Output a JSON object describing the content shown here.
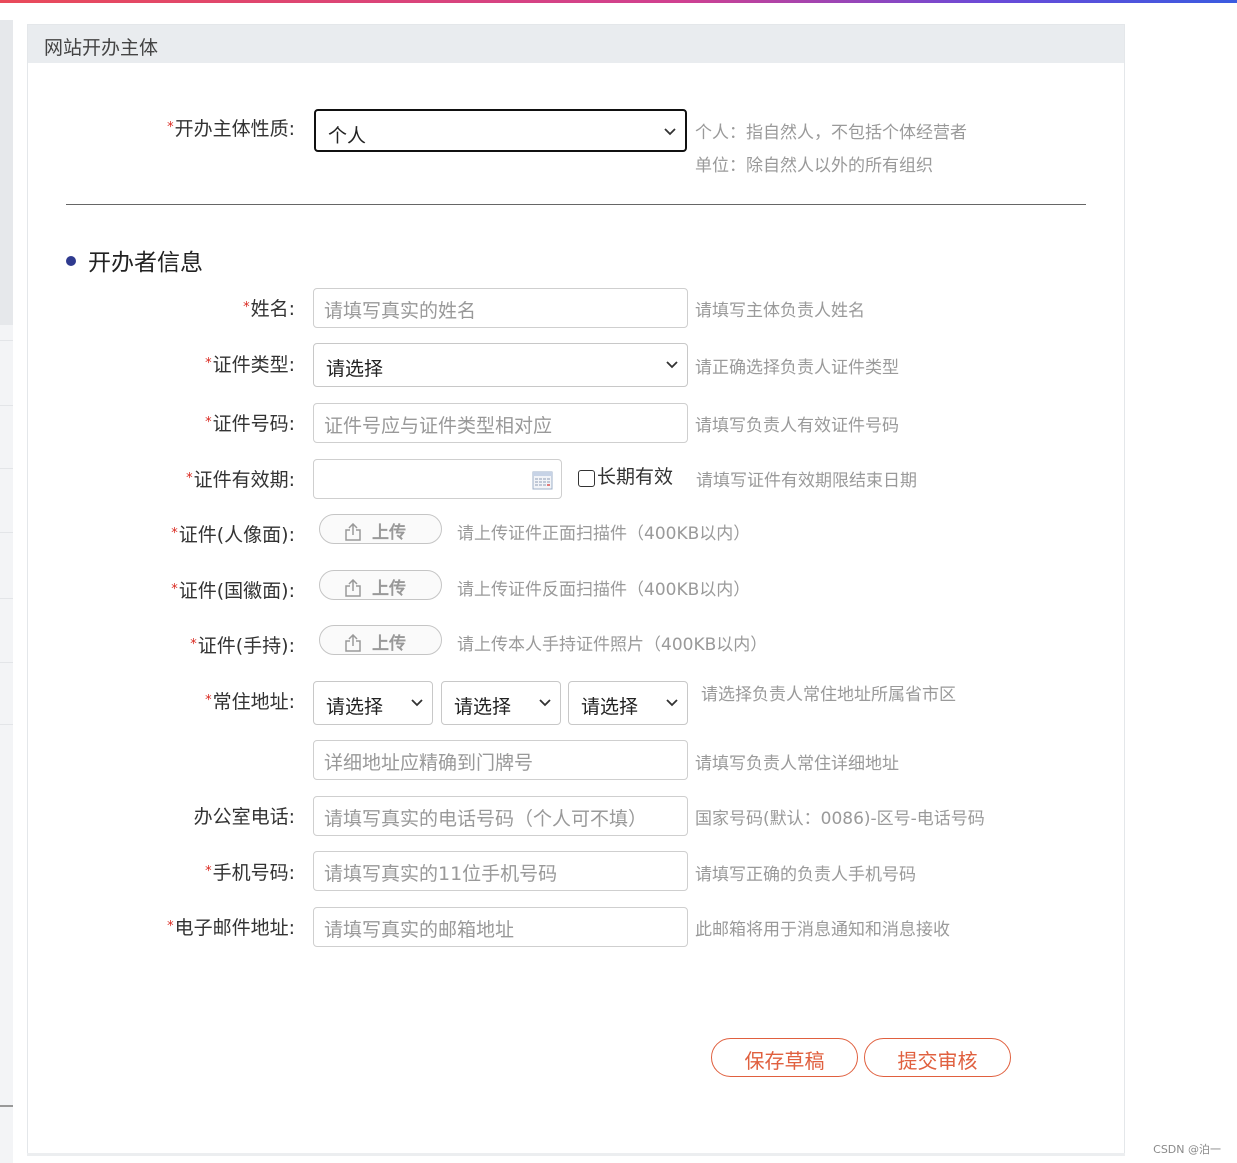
{
  "panel": {
    "title": "网站开办主体"
  },
  "subject_type": {
    "label": "开办主体性质:",
    "selected": "个人",
    "hint_person": "个人：指自然人，不包括个体经营者",
    "hint_org": "单位：除自然人以外的所有组织"
  },
  "section": {
    "title": "开办者信息"
  },
  "fields": {
    "name": {
      "label": "姓名:",
      "placeholder": "请填写真实的姓名",
      "hint": "请填写主体负责人姓名"
    },
    "id_type": {
      "label": "证件类型:",
      "selected": "请选择",
      "hint": "请正确选择负责人证件类型"
    },
    "id_number": {
      "label": "证件号码:",
      "placeholder": "证件号应与证件类型相对应",
      "hint": "请填写负责人有效证件号码"
    },
    "id_expiry": {
      "label": "证件有效期:",
      "long_term_label": "长期有效",
      "hint": "请填写证件有效期限结束日期"
    },
    "id_front": {
      "label": "证件(人像面):",
      "button": "上传",
      "hint": "请上传证件正面扫描件（400KB以内）"
    },
    "id_back": {
      "label": "证件(国徽面):",
      "button": "上传",
      "hint": "请上传证件反面扫描件（400KB以内）"
    },
    "id_handheld": {
      "label": "证件(手持):",
      "button": "上传",
      "hint": "请上传本人手持证件照片（400KB以内）"
    },
    "address": {
      "label": "常住地址:",
      "province": "请选择",
      "city": "请选择",
      "district": "请选择",
      "hint": "请选择负责人常住地址所属省市区",
      "detail_placeholder": "详细地址应精确到门牌号",
      "detail_hint": "请填写负责人常住详细地址"
    },
    "office_phone": {
      "label": "办公室电话:",
      "placeholder": "请填写真实的电话号码（个人可不填）",
      "hint": "国家号码(默认：0086)-区号-电话号码"
    },
    "mobile": {
      "label": "手机号码:",
      "placeholder": "请填写真实的11位手机号码",
      "hint": "请填写正确的负责人手机号码"
    },
    "email": {
      "label": "电子邮件地址:",
      "placeholder": "请填写真实的邮箱地址",
      "hint": "此邮箱将用于消息通知和消息接收"
    }
  },
  "actions": {
    "save_draft": "保存草稿",
    "submit": "提交审核"
  },
  "watermark": "CSDN @泊一",
  "colors": {
    "required": "#d9271e",
    "accent_button": "#e0603f",
    "section_dot": "#2f3a8f"
  },
  "icons": {
    "upload": "upload-icon",
    "calendar": "calendar-icon",
    "chevron": "chevron-down-icon"
  }
}
